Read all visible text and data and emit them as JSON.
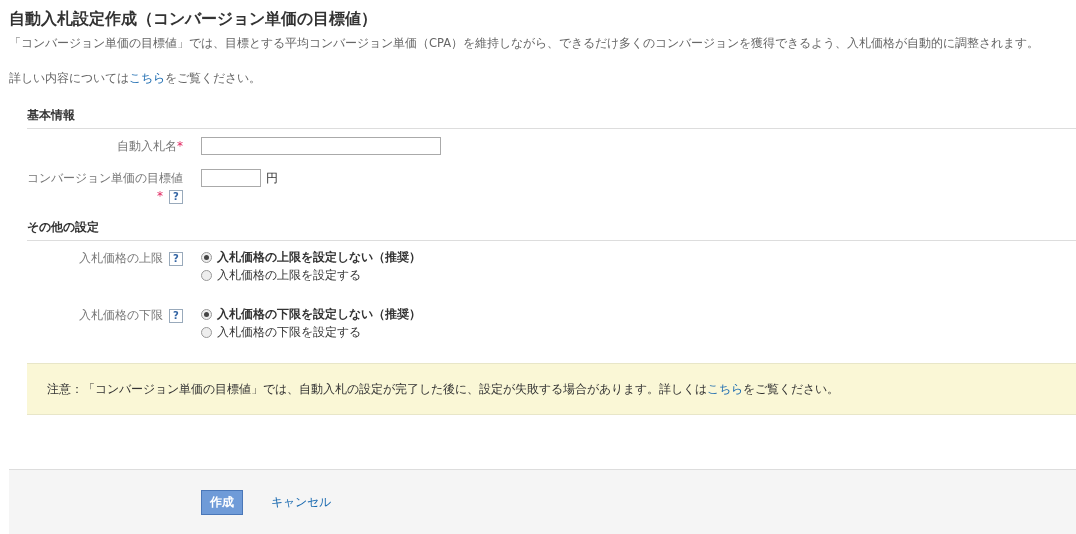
{
  "title": "自動入札設定作成（コンバージョン単価の目標値）",
  "description": "「コンバージョン単価の目標値」では、目標とする平均コンバージョン単価（CPA）を維持しながら、できるだけ多くのコンバージョンを獲得できるよう、入札価格が自動的に調整されます。",
  "details": {
    "before": "詳しい内容については",
    "link": "こちら",
    "after": "をご覧ください。"
  },
  "sections": [
    {
      "heading": "基本情報",
      "fields": [
        {
          "kind": "text",
          "label": "自動入札名",
          "required": "*"
        },
        {
          "kind": "amount",
          "label": "コンバージョン単価の目標値",
          "required": "*",
          "help": "?",
          "unit": "円"
        }
      ]
    },
    {
      "heading": "その他の設定",
      "fields": [
        {
          "kind": "radio",
          "label": "入札価格の上限",
          "help": "?",
          "options": [
            {
              "label": "入札価格の上限を設定しない（推奨）",
              "selected": true
            },
            {
              "label": "入札価格の上限を設定する",
              "selected": false
            }
          ]
        },
        {
          "kind": "radio",
          "label": "入札価格の下限",
          "help": "?",
          "options": [
            {
              "label": "入札価格の下限を設定しない（推奨）",
              "selected": true
            },
            {
              "label": "入札価格の下限を設定する",
              "selected": false
            }
          ]
        }
      ]
    }
  ],
  "notice": {
    "before": "注意：「コンバージョン単価の目標値」では、自動入札の設定が完了した後に、設定が失敗する場合があります。詳しくは",
    "link": "こちら",
    "after": "をご覧ください。"
  },
  "buttons": {
    "submit": "作成",
    "cancel": "キャンセル"
  }
}
